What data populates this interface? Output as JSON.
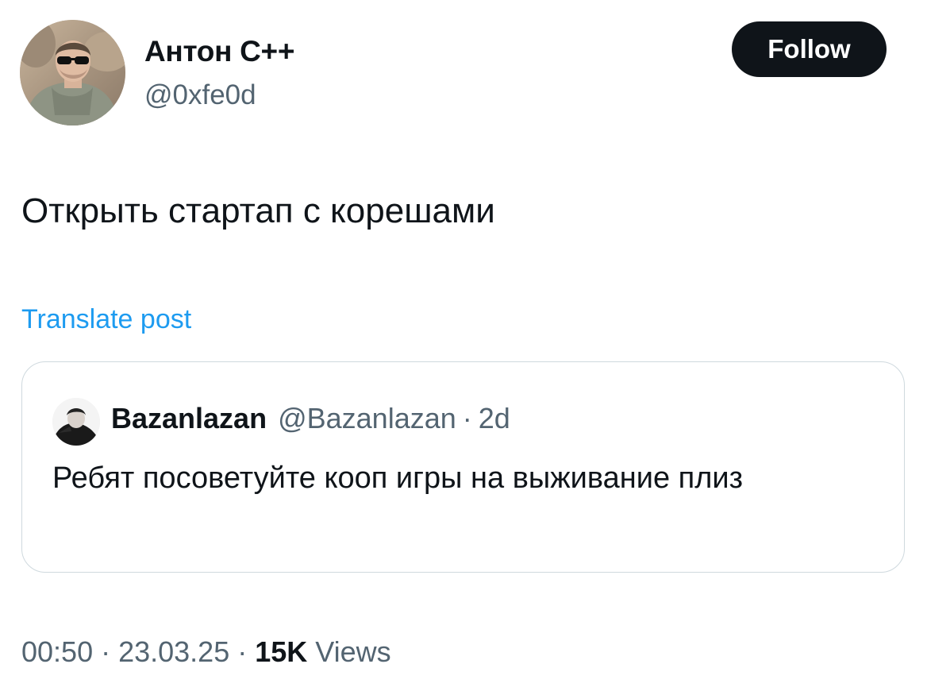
{
  "author": {
    "name": "Антон С++",
    "handle": "@0xfe0d",
    "avatar_icon": "user-avatar-photo"
  },
  "follow_label": "Follow",
  "tweet": {
    "text": "Открыть стартап с корешами",
    "translate_label": "Translate post"
  },
  "quote": {
    "name": "Bazanlazan",
    "handle": "@Bazanlazan",
    "separator": "·",
    "time": "2d",
    "text": "Ребят посоветуйте кооп игры на выживание плиз",
    "avatar_icon": "quoted-user-avatar"
  },
  "meta": {
    "time": "00:50",
    "separator": "·",
    "date": "23.03.25",
    "views_count": "15K",
    "views_label": "Views"
  },
  "colors": {
    "text": "#0f1419",
    "secondary": "#536471",
    "link": "#1d9bf0",
    "border": "#cfd9de",
    "button_bg": "#0f1419"
  }
}
